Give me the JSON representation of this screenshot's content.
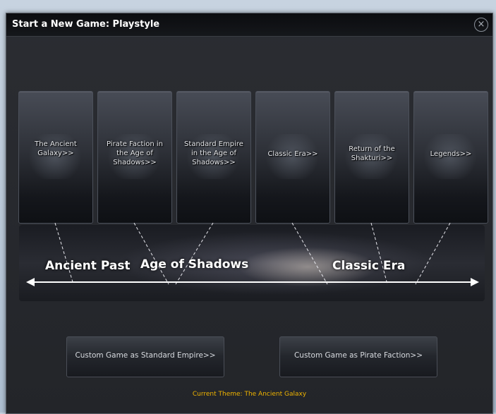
{
  "dialog": {
    "title": "Start a New Game: Playstyle",
    "close_glyph": "×"
  },
  "cards": [
    {
      "label": "The Ancient Galaxy>>",
      "icon": "ancient-galaxy-icon"
    },
    {
      "label": "Pirate Faction in the Age of Shadows>>",
      "icon": "skull-icon"
    },
    {
      "label": "Standard Empire in the Age of Shadows>>",
      "icon": "empire-icon"
    },
    {
      "label": "Classic Era>>",
      "icon": "classic-era-icon"
    },
    {
      "label": "Return of the Shakturi>>",
      "icon": "shakturi-icon"
    },
    {
      "label": "Legends>>",
      "icon": "legends-icon"
    }
  ],
  "timeline": {
    "ancient_past": "Ancient Past",
    "age_of_shadows": "Age of Shadows",
    "classic_era": "Classic Era"
  },
  "buttons": {
    "custom_empire": "Custom Game as Standard Empire>>",
    "custom_pirate": "Custom Game as Pirate Faction>>"
  },
  "footer": {
    "current_theme": "Current Theme: The Ancient Galaxy"
  },
  "colors": {
    "accent_theme": "#f0b400",
    "title_text": "#ffffff"
  }
}
